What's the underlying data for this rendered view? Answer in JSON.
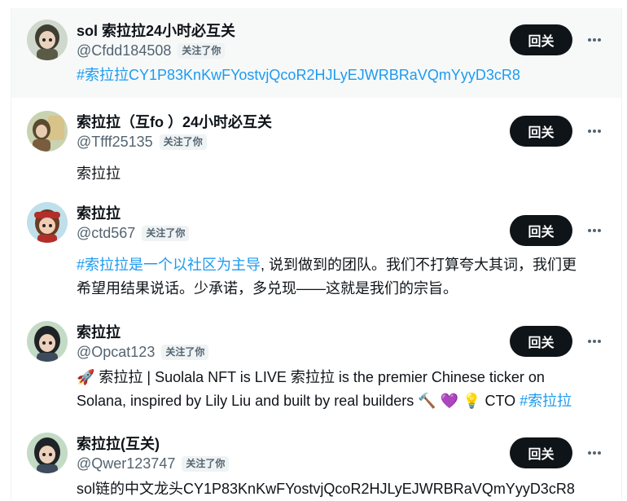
{
  "users": [
    {
      "name": "sol 索拉拉24小时必互关",
      "handle": "@Cfdd184508",
      "badge": "关注了你",
      "button": "回关",
      "bio_link": "#索拉拉CY1P83KnKwFYostvjQcoR2HJLyEJWRBRaVQmYyyD3cR8",
      "avatar_colors": [
        "#cfd8cc",
        "#5b5a46",
        "#e9d2bd"
      ]
    },
    {
      "name": "索拉拉（互fo ）24小时必互关",
      "handle": "@Tfff25135",
      "badge": "关注了你",
      "button": "回关",
      "bio": "索拉拉",
      "avatar_colors": [
        "#c9d3b1",
        "#5a4a2f",
        "#e8cdb2"
      ]
    },
    {
      "name": "索拉拉",
      "handle": "@ctd567",
      "badge": "关注了你",
      "button": "回关",
      "bio_link": "#索拉拉是一个以社区为主导",
      "bio_rest_1": ", 说到做到的团队。我们不打算夸大其词，我们更",
      "bio_line_2": "希望用结果说话。少承诺，多兑现——这就是我们的宗旨。",
      "avatar_colors": [
        "#bfe0ea",
        "#b32e2a",
        "#f2cdb6"
      ]
    },
    {
      "name": "索拉拉",
      "handle": "@Opcat123",
      "badge": "关注了你",
      "button": "回关",
      "bio_line_1": "🚀 索拉拉 | Suolala NFT is LIVE 索拉拉 is the premier Chinese ticker on",
      "bio_line_2": "Solana, inspired by Lily Liu and built by real builders 🔨 💜 💡 CTO ",
      "bio_link": "#索拉拉",
      "avatar_colors": [
        "#c3dbc6",
        "#1f2326",
        "#ecd1bd"
      ]
    },
    {
      "name": "索拉拉(互关)",
      "handle": "@Qwer123747",
      "badge": "关注了你",
      "button": "回关",
      "bio": "sol链的中文龙头CY1P83KnKwFYostvjQcoR2HJLyEJWRBRaVQmYyyD3cR8",
      "avatar_colors": [
        "#c3dbc6",
        "#1f2326",
        "#ecd1bd"
      ]
    }
  ],
  "colors": {
    "accent": "#1d9bf0",
    "button_bg": "#0f1419",
    "secondary_text": "#536471",
    "highlight_bg": "#f7f9f9"
  },
  "icons": {
    "more": "more-horizontal-icon"
  }
}
